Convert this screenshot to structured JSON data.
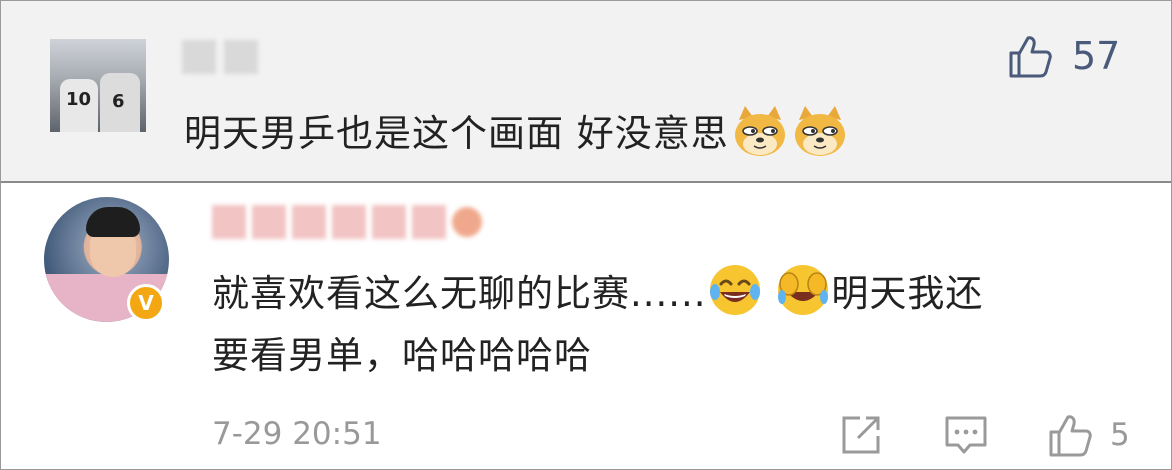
{
  "comment1": {
    "text": "明天男乒也是这个画面 好没意思",
    "emojis": [
      "doge",
      "doge"
    ],
    "like_count": "57",
    "avatar_jersey_numbers": [
      "10",
      "6"
    ]
  },
  "comment2": {
    "line_part1": "就喜欢看这么无聊的比赛......",
    "line_part2": "明天我还",
    "line2": "要看男单，哈哈哈哈哈",
    "emojis": [
      "laughing-tears",
      "rolling-laughing"
    ],
    "verified_badge": "V",
    "timestamp": "7-29 20:51",
    "like_count": "5"
  },
  "colors": {
    "top_card_bg": "#f2f2f2",
    "text_primary": "#222222",
    "text_secondary": "#999999",
    "like_icon_top": "#4a5a7a",
    "verified_orange": "#f3a712"
  }
}
